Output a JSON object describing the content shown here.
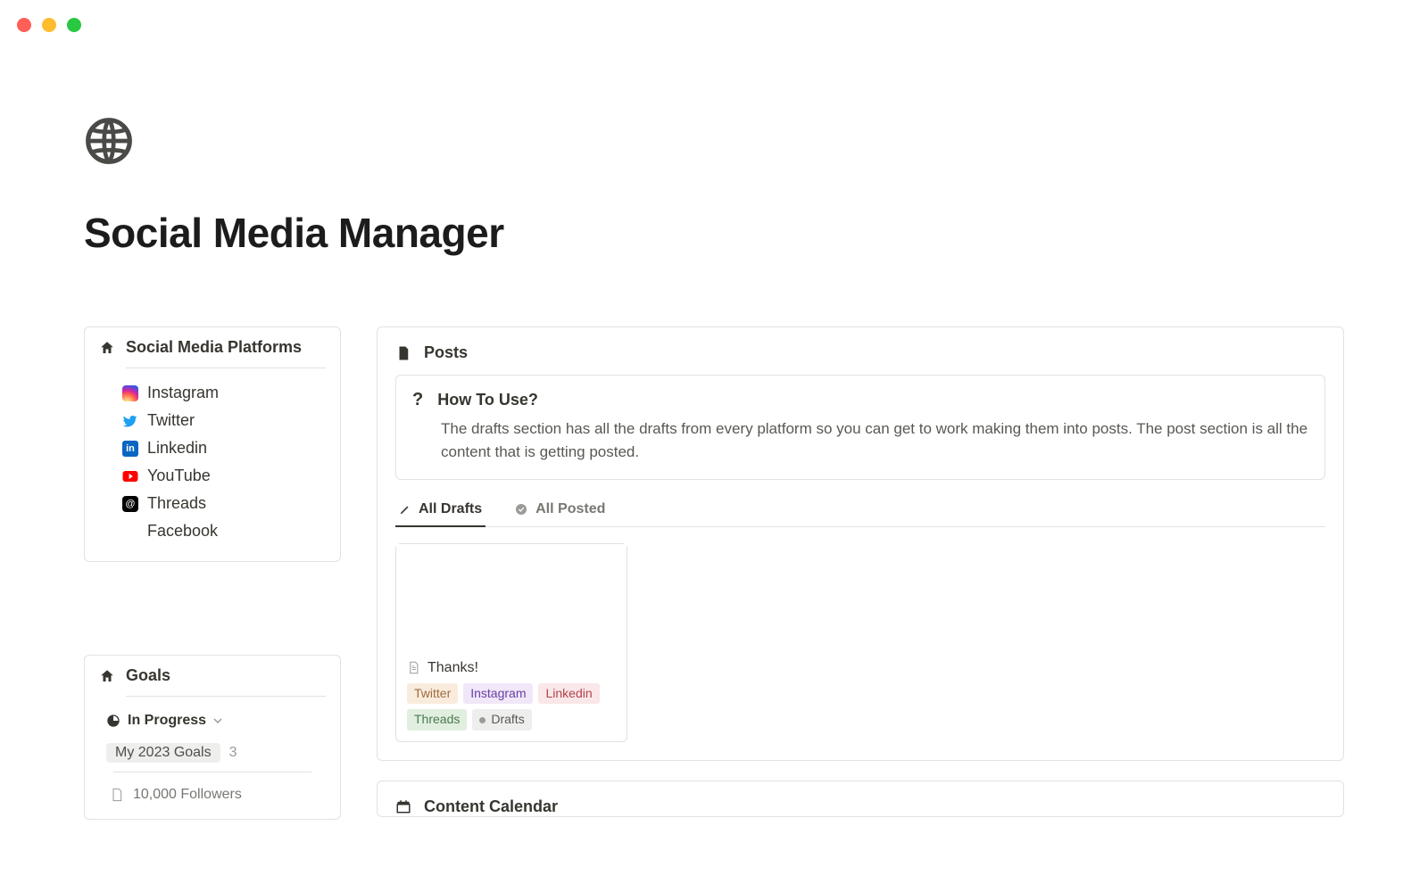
{
  "page_title": "Social Media Manager",
  "sidebar": {
    "platforms_header": "Social Media Platforms",
    "platforms": [
      {
        "label": "Instagram"
      },
      {
        "label": "Twitter"
      },
      {
        "label": "Linkedin"
      },
      {
        "label": "YouTube"
      },
      {
        "label": "Threads"
      },
      {
        "label": "Facebook"
      }
    ],
    "goals_header": "Goals",
    "goals_view_label": "In Progress",
    "goals_group_label": "My 2023 Goals",
    "goals_group_count": "3",
    "goals_item_1": "10,000 Followers"
  },
  "posts": {
    "header": "Posts",
    "callout_title": "How To Use?",
    "callout_body": "The drafts section has all the drafts from every platform so you can get to work making them into posts. The post section is all the content that is getting posted.",
    "tabs": {
      "drafts": "All Drafts",
      "posted": "All Posted"
    },
    "draft_card": {
      "title": "Thanks!",
      "tags": [
        "Twitter",
        "Instagram",
        "Linkedin",
        "Threads",
        "Drafts"
      ]
    }
  },
  "content_calendar_header": "Content Calendar"
}
